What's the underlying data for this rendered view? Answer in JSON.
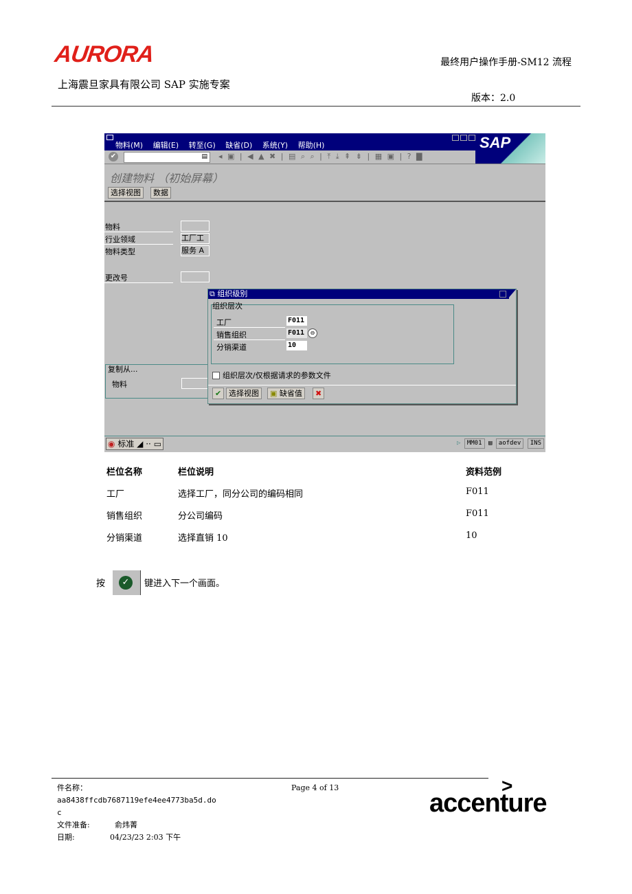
{
  "header": {
    "logo_text": "AURORA",
    "doc_title": "最终用户操作手册-SM12 流程",
    "company": "上海震旦家具有限公司 SAP 实施专案",
    "version": "版本：2.0"
  },
  "sap": {
    "menu": [
      "物料(M)",
      "编辑(E)",
      "转至(G)",
      "缺省(D)",
      "系统(Y)",
      "帮助(H)"
    ],
    "brand": "SAP",
    "command_value": "",
    "toolbar_icons": "◂ ▣ | ◀ ▲ ✖ | ▤ ⌕ ⌕ | ⤒ ⤓ ⇞ ⇟ | ▦ ▣ | ? ▇",
    "screen_title": "创建物料 （初始屏幕）",
    "app_buttons": [
      "选择视图",
      "数据"
    ],
    "fields": [
      {
        "label": "物料",
        "value": ""
      },
      {
        "label": "行业领域",
        "value": "工厂工"
      },
      {
        "label": "物料类型",
        "value": "服务 A"
      },
      {
        "label": "更改号",
        "value": ""
      }
    ],
    "copy_from": {
      "title": "复制从...",
      "field_label": "物料",
      "value": ""
    },
    "dialog": {
      "title": "组织级别",
      "group_title": "组织层次",
      "rows": [
        {
          "label": "工厂",
          "value": "F011"
        },
        {
          "label": "销售组织",
          "value": "F011"
        },
        {
          "label": "分销渠道",
          "value": "10"
        }
      ],
      "checkbox_label": "组织层次/仅根据请求的参数文件",
      "checkbox_checked": false,
      "buttons": {
        "select_views": "选择视图",
        "defaults": "缺省值"
      }
    },
    "status": {
      "mode": "标准",
      "transaction": "MM01",
      "server": "aofdev",
      "insert_mode": "INS"
    }
  },
  "table": {
    "headers": [
      "栏位名称",
      "栏位说明",
      "资料范例"
    ],
    "rows": [
      [
        "工厂",
        "选择工厂，同分公司的编码相同",
        "F011"
      ],
      [
        "销售组织",
        "分公司编码",
        "F011"
      ],
      [
        "分销渠道",
        "选择直销 10",
        "10"
      ]
    ]
  },
  "instruction": {
    "before": "按",
    "after": "键进入下一个画面。"
  },
  "footer": {
    "file_label": "件名称：",
    "file_name": "aa8438ffcdb7687119efe4ee4773ba5d.do",
    "file_name_tail": "c",
    "page": "Page 4 of 13",
    "prepared_label": "文件准备:",
    "prepared_by": "俞炜菁",
    "date_label": "日期:",
    "date": "04/23/23 2:03 下午",
    "brand_logo": "accenture",
    "brand_mark": ">"
  }
}
